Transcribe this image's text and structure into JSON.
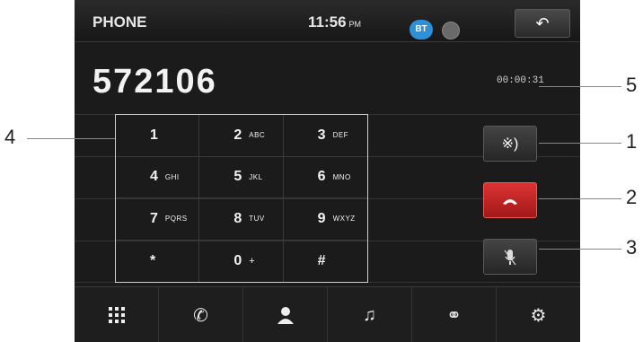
{
  "status_bar": {
    "app_title": "PHONE",
    "time": "11:56",
    "ampm": "PM",
    "bt_badge": "BT",
    "back_icon": "back-arrow-icon"
  },
  "call": {
    "number": "572106",
    "timer": "00:00:31"
  },
  "keypad": [
    {
      "digit": "1",
      "letters": ""
    },
    {
      "digit": "2",
      "letters": "ABC"
    },
    {
      "digit": "3",
      "letters": "DEF"
    },
    {
      "digit": "4",
      "letters": "GHI"
    },
    {
      "digit": "5",
      "letters": "JKL"
    },
    {
      "digit": "6",
      "letters": "MNO"
    },
    {
      "digit": "7",
      "letters": "PQRS"
    },
    {
      "digit": "8",
      "letters": "TUV"
    },
    {
      "digit": "9",
      "letters": "WXYZ"
    },
    {
      "digit": "*",
      "letters": ""
    },
    {
      "digit": "0",
      "letters": "+"
    },
    {
      "digit": "#",
      "letters": ""
    }
  ],
  "side_buttons": [
    {
      "icon": "bluetooth-audio-icon"
    },
    {
      "icon": "end-call-icon",
      "color": "#c62828"
    },
    {
      "icon": "mic-mute-icon"
    }
  ],
  "bottom_nav": [
    {
      "icon": "keypad-grid-icon"
    },
    {
      "icon": "call-history-icon"
    },
    {
      "icon": "contacts-icon"
    },
    {
      "icon": "music-icon"
    },
    {
      "icon": "link-icon"
    },
    {
      "icon": "settings-gear-icon"
    }
  ],
  "callouts": {
    "c1": "1",
    "c2": "2",
    "c3": "3",
    "c4": "4",
    "c5": "5"
  }
}
